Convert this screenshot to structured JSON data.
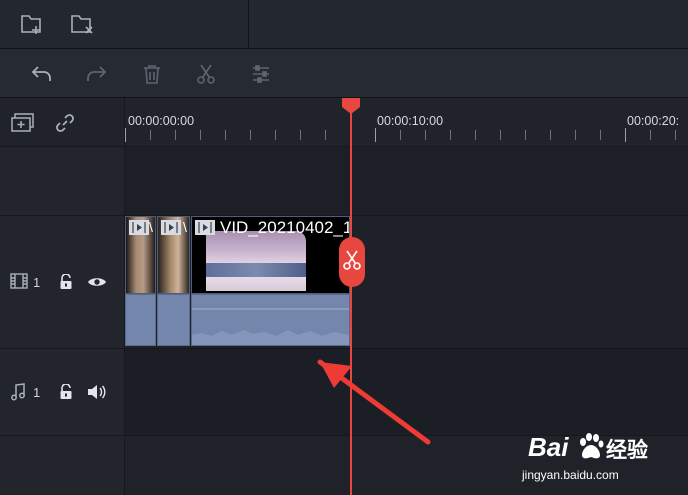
{
  "topbar": {
    "icons": [
      "add-folder-icon",
      "remove-folder-icon"
    ]
  },
  "toolbar": {
    "icons": [
      "undo-icon",
      "redo-icon",
      "delete-icon",
      "scissors-icon",
      "adjust-icon"
    ]
  },
  "timeline": {
    "tools": [
      "add-track-icon",
      "link-icon"
    ],
    "ruler": {
      "labels": [
        "00:00:00:00",
        "00:00:10:00",
        "00:00:20:"
      ]
    },
    "video_track": {
      "number": "1",
      "clip_title": "VID_20210402_1",
      "small_clip_letters": [
        "\\",
        "\\"
      ]
    },
    "audio_track": {
      "number": "1"
    },
    "playhead_color": "#e8473f"
  },
  "watermark": {
    "brand": "Bai",
    "brand_tail": "经验",
    "url": "jingyan.baidu.com"
  }
}
